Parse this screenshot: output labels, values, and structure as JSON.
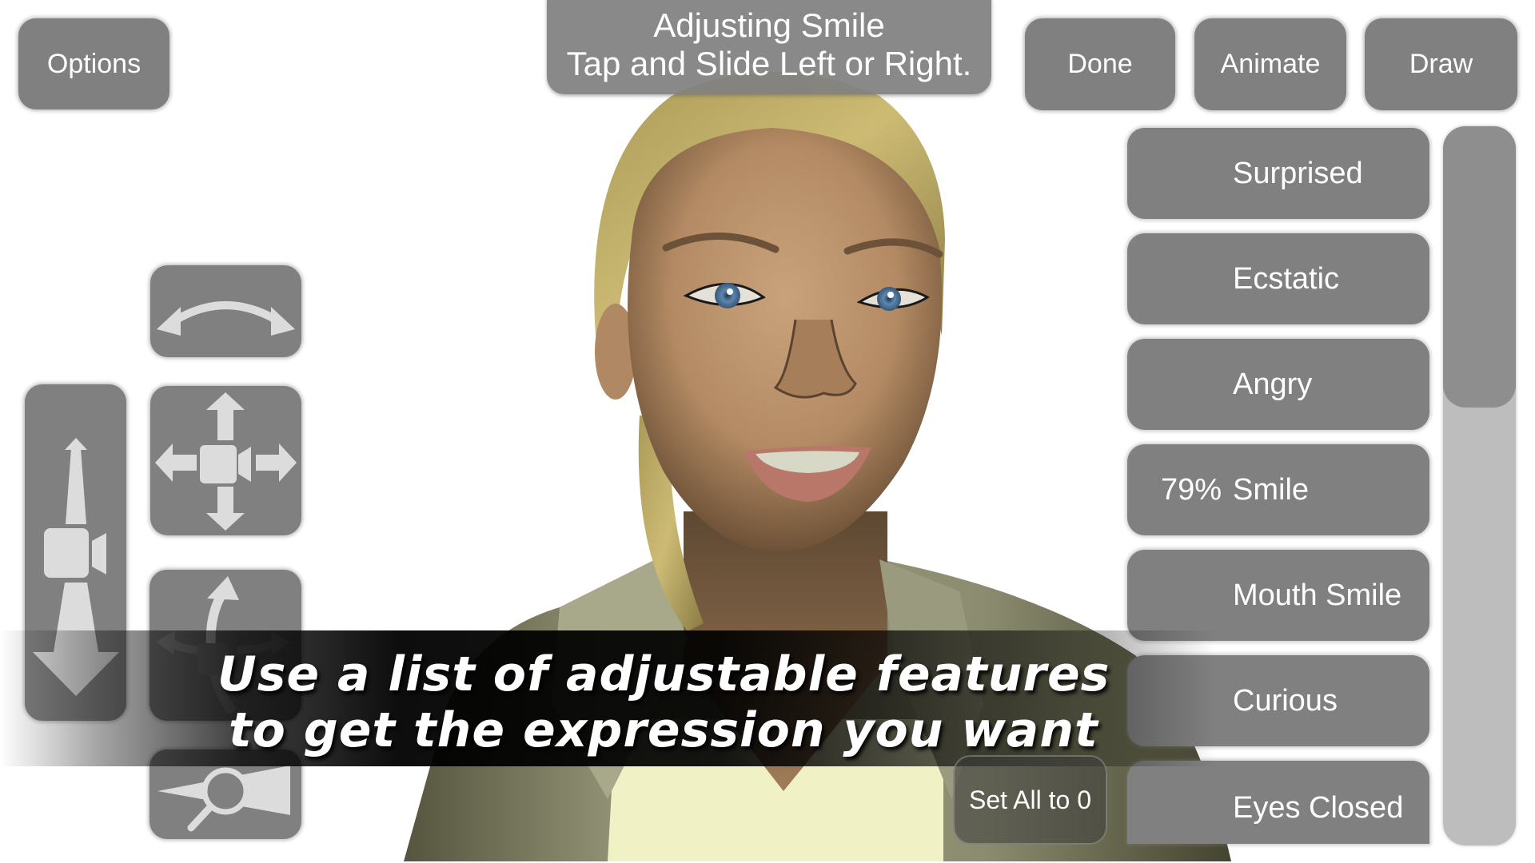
{
  "app": {
    "mode_title": "Adjusting Smile",
    "mode_hint": "Tap and Slide Left or Right."
  },
  "toolbar": {
    "options_label": "Options",
    "done_label": "Done",
    "animate_label": "Animate",
    "draw_label": "Draw"
  },
  "camera_controls": [
    {
      "name": "orbit",
      "icon": "curved-double-arrow-icon"
    },
    {
      "name": "dolly",
      "icon": "camera-forward-back-icon"
    },
    {
      "name": "pan",
      "icon": "camera-four-way-arrows-icon"
    },
    {
      "name": "rotate",
      "icon": "camera-rotate-arrows-icon"
    },
    {
      "name": "zoom",
      "icon": "magnify-zoom-icon"
    }
  ],
  "expressions": {
    "items": [
      {
        "label": "Surprised",
        "value": ""
      },
      {
        "label": "Ecstatic",
        "value": ""
      },
      {
        "label": "Angry",
        "value": ""
      },
      {
        "label": "Smile",
        "value": "79%"
      },
      {
        "label": "Mouth Smile",
        "value": ""
      },
      {
        "label": "Curious",
        "value": ""
      },
      {
        "label": "Eyes Closed",
        "value": ""
      }
    ],
    "selected": "Smile",
    "scroll_position": 0.0,
    "set_all_label": "Set All to 0"
  },
  "caption": {
    "line1": "Use a list of adjustable features",
    "line2": "to get the expression you want"
  },
  "colors": {
    "button_gray": "#808080",
    "scroll_track": "#bdbdbd",
    "scroll_thumb": "#8e8e8e",
    "icon_light": "#dcdcdc"
  }
}
